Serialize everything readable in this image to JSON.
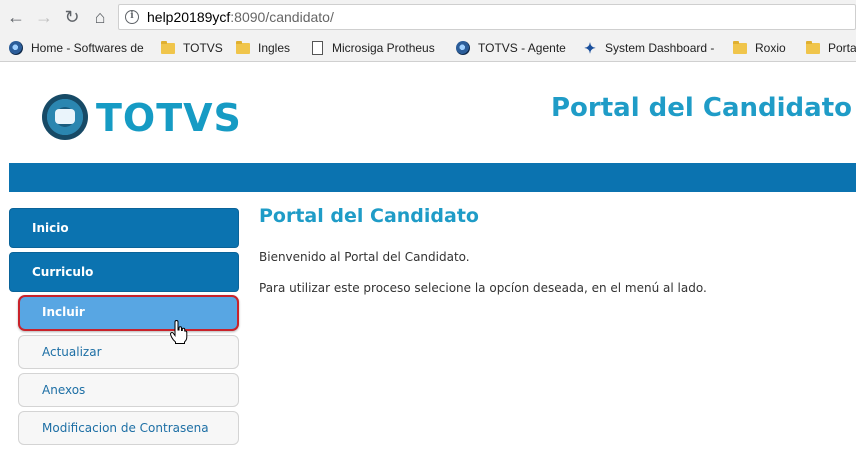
{
  "browser": {
    "back_icon": "back-arrow-icon",
    "forward_icon": "forward-arrow-icon",
    "reload_icon": "reload-icon",
    "home_icon": "home-icon",
    "url_host": "help20189ycf",
    "url_path": ":8090/candidato/",
    "bookmarks": [
      {
        "label": "Home - Softwares de",
        "icon": "globe-icon"
      },
      {
        "label": "TOTVS",
        "icon": "folder-icon"
      },
      {
        "label": "Ingles",
        "icon": "folder-icon"
      },
      {
        "label": "Microsiga Protheus",
        "icon": "page-icon"
      },
      {
        "label": "TOTVS - Agente",
        "icon": "globe-icon"
      },
      {
        "label": "System Dashboard -",
        "icon": "jira-icon"
      },
      {
        "label": "Roxio",
        "icon": "folder-icon"
      },
      {
        "label": "Porta",
        "icon": "folder-icon"
      }
    ]
  },
  "header": {
    "logo_text": "TOTVS",
    "site_title": "Portal del Candidato"
  },
  "sidebar": {
    "inicio": "Inicio",
    "curriculo": "Curriculo",
    "incluir": "Incluir",
    "actualizar": "Actualizar",
    "anexos": "Anexos",
    "modificacion": "Modificacion de Contrasena"
  },
  "main": {
    "title": "Portal del Candidato",
    "welcome": "Bienvenido al Portal del Candidato.",
    "instructions": "Para utilizar este proceso selecione la opcíon deseada, en el menú al lado."
  },
  "colors": {
    "brand_blue": "#0b73b0",
    "title_blue": "#1f9cc7",
    "active_item": "#58a6e3",
    "highlight_border": "#c9222a"
  }
}
